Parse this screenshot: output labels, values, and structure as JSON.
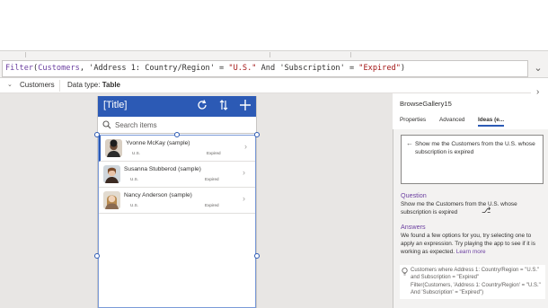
{
  "formula": {
    "fn": "Filter",
    "open": "(",
    "table": "Customers",
    "comma1": ", ",
    "field1": "'Address 1: Country/Region'",
    "eq1": " = ",
    "val1": "\"U.S.\"",
    "and": " And ",
    "field2": "'Subscription'",
    "eq2": " = ",
    "val2": "\"Expired\"",
    "close": ")"
  },
  "source_bar": {
    "source_name": "Customers",
    "data_type_label": "Data type:",
    "data_type_value": "Table"
  },
  "app": {
    "title": "[Title]",
    "search_placeholder": "Search items",
    "items": [
      {
        "name": "Yvonne McKay (sample)",
        "country": "U.S.",
        "status": "Expired"
      },
      {
        "name": "Susanna Stubberod (sample)",
        "country": "U.S.",
        "status": "Expired"
      },
      {
        "name": "Nancy Anderson (sample)",
        "country": "U.S.",
        "status": "Expired"
      }
    ]
  },
  "panel": {
    "gallery_name": "BrowseGallery15",
    "tabs": [
      "Properties",
      "Advanced",
      "Ideas (e..."
    ],
    "query": "Show me the Customers from the U.S. whose subscription is expired",
    "question_title": "Question",
    "question_text": "Show me the Customers from the U.S. whose subscription is expired",
    "answers_title": "Answers",
    "answers_text": "We found a few options for you, try selecting one to apply an expression. Try playing the app to see if it is working as expected.",
    "learn_more": "Learn more",
    "answer_desc": "Customers where Address 1: Country/Region = \"U.S.\" and Subscription = \"Expired\"",
    "answer_formula": "Filter(Customers, 'Address 1: Country/Region' = \"U.S.\" And 'Subscription' = \"Expired\")"
  },
  "colors": {
    "header_blue": "#2c5ab5",
    "accent_purple": "#6b3fa0",
    "string_red": "#a31515"
  },
  "icons": [
    "refresh-icon",
    "sort-icon",
    "add-icon",
    "search-icon",
    "chevron-right-icon",
    "back-arrow-icon",
    "lightbulb-icon"
  ]
}
